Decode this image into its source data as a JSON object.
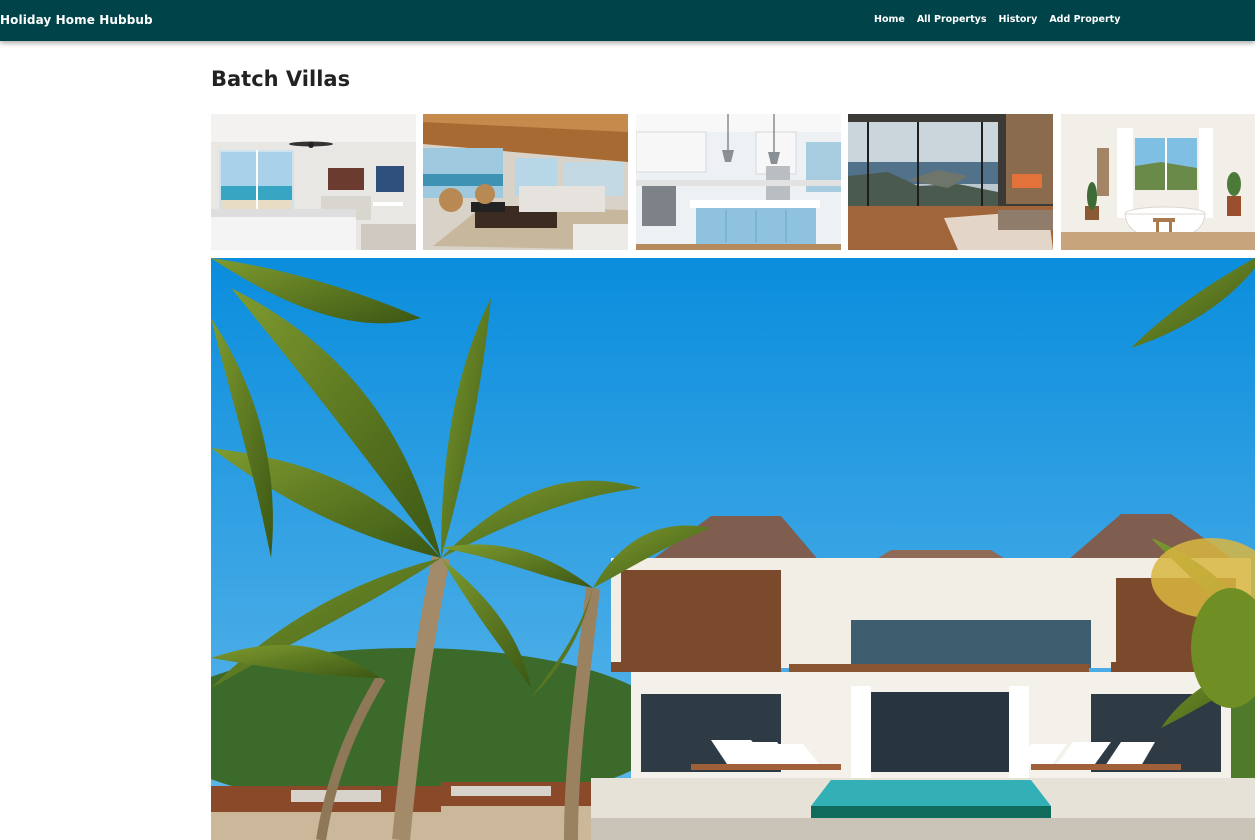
{
  "navbar": {
    "brand": "Holiday Home Hubbub",
    "links": [
      "Home",
      "All Propertys",
      "History",
      "Add Property"
    ]
  },
  "property": {
    "title": "Batch Villas"
  },
  "gallery": {
    "thumbnails": [
      "bedroom-ocean-view",
      "living-room-wood-ceiling",
      "white-kitchen-blue-island",
      "bedroom-cliff-coast-view",
      "bathroom-freestanding-tub"
    ],
    "main_image": "beachfront-villa-with-palms-and-pool"
  },
  "colors": {
    "navbar_bg": "#004449",
    "sky": "#1594e0",
    "palm": "#5f7d1f"
  }
}
